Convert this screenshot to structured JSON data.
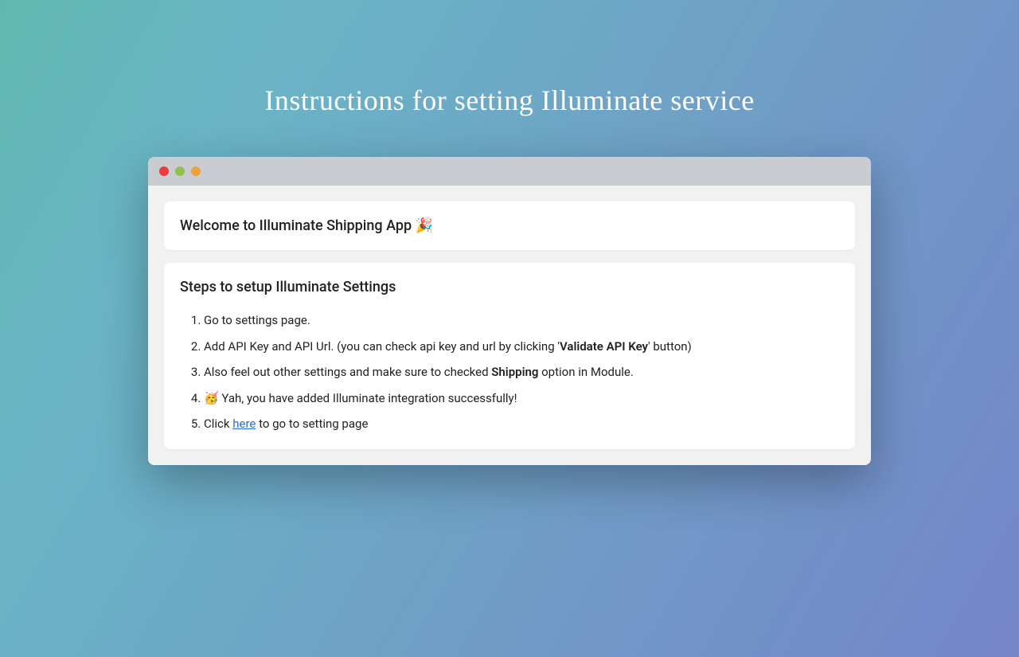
{
  "header": {
    "title": "Instructions for setting Illuminate service"
  },
  "welcome": {
    "text": "Welcome to Illuminate Shipping App 🎉"
  },
  "steps": {
    "title": "Steps to setup Illuminate Settings",
    "items": {
      "1": "Go to settings page.",
      "2_prefix": "Add API Key and API Url. (you can check api key and url by clicking '",
      "2_bold": "Validate API Key",
      "2_suffix": "' button)",
      "3_prefix": "Also feel out other settings and make sure to checked ",
      "3_bold": "Shipping",
      "3_suffix": " option in Module.",
      "4": "🥳 Yah, you have added Illuminate integration successfully!",
      "5_prefix": "Click ",
      "5_link": "here",
      "5_suffix": " to go to setting page"
    }
  }
}
